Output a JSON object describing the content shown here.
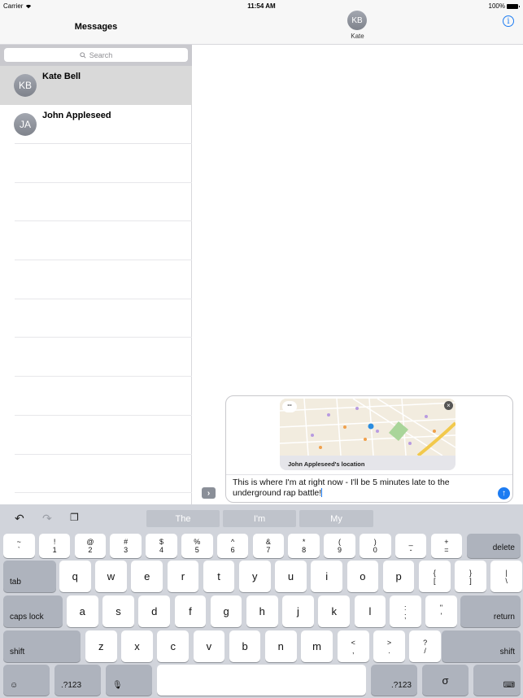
{
  "status_bar": {
    "carrier": "Carrier",
    "time": "11:54 AM",
    "battery": "100%"
  },
  "sidebar": {
    "title": "Messages",
    "search_placeholder": "Search",
    "conversations": [
      {
        "initials": "KB",
        "name": "Kate Bell",
        "selected": true
      },
      {
        "initials": "JA",
        "name": "John Appleseed",
        "selected": false
      }
    ]
  },
  "conversation": {
    "contact_initials": "KB",
    "contact_name": "Kate",
    "attachment": {
      "app_icon": "°°",
      "label": "John Appleseed's location",
      "close": "×"
    },
    "message_text": "This is where I'm at right now - I'll be 5 minutes late to the underground rap battle!",
    "expand_glyph": "›",
    "send_glyph": "↑",
    "info_glyph": "i"
  },
  "keyboard": {
    "suggestions": [
      "The",
      "I'm",
      "My"
    ],
    "tools": {
      "undo": "↶",
      "redo": "↷",
      "paste": "❐"
    },
    "row1": [
      [
        "~",
        "`"
      ],
      [
        "!",
        "1"
      ],
      [
        "@",
        "2"
      ],
      [
        "#",
        "3"
      ],
      [
        "$",
        "4"
      ],
      [
        "%",
        "5"
      ],
      [
        "^",
        "6"
      ],
      [
        "&",
        "7"
      ],
      [
        "*",
        "8"
      ],
      [
        "(",
        "9"
      ],
      [
        ")",
        "0"
      ],
      [
        "_",
        "-"
      ],
      [
        "+",
        "="
      ]
    ],
    "delete": "delete",
    "tab": "tab",
    "row2": [
      "q",
      "w",
      "e",
      "r",
      "t",
      "y",
      "u",
      "i",
      "o",
      "p"
    ],
    "row2_sym": [
      [
        "{",
        "["
      ],
      [
        "}",
        "]"
      ],
      [
        "|",
        "\\"
      ]
    ],
    "caps": "caps lock",
    "row3": [
      "a",
      "s",
      "d",
      "f",
      "g",
      "h",
      "j",
      "k",
      "l"
    ],
    "row3_sym": [
      [
        ":",
        ";"
      ],
      [
        "\"",
        "'"
      ]
    ],
    "return": "return",
    "shift": "shift",
    "row4": [
      "z",
      "x",
      "c",
      "v",
      "b",
      "n",
      "m"
    ],
    "row4_sym": [
      [
        "<",
        ","
      ],
      [
        ">",
        "."
      ],
      [
        "?",
        "/"
      ]
    ],
    "numbers": ".?123",
    "emoji": "☺",
    "mic": "🎙",
    "handwriting": "σ",
    "hide": "⌨"
  }
}
